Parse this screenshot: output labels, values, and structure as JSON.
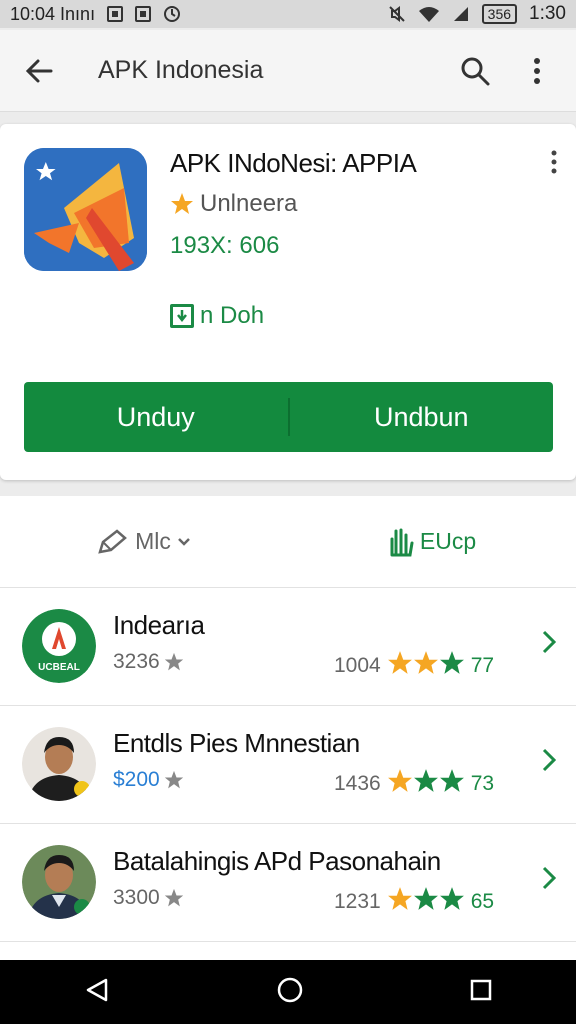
{
  "status_bar": {
    "left_text": "10:04 Inını",
    "battery_text": "356",
    "time": "1:30"
  },
  "app_bar": {
    "title": "APK Indonesia",
    "icons": [
      "back-arrow-icon",
      "search-icon",
      "more-vert-icon"
    ]
  },
  "app_card": {
    "name": "APK INdoNesi: APPIA",
    "rating_label": "Unlneera",
    "size_text": "193X: 606",
    "install_label": "n Doh",
    "buttons": [
      "Unduy",
      "Undbun"
    ]
  },
  "tabs": {
    "left_label": "Mlc",
    "right_label": "EUcp"
  },
  "list": [
    {
      "title": "Indearıa",
      "count": "3236",
      "rating_count": "1004",
      "score": "77",
      "star_colors": [
        "#f5a623",
        "#f5a623",
        "#1b8a45"
      ]
    },
    {
      "title": "Entdls Pies Mnnestian",
      "count": "$200",
      "rating_count": "1436",
      "score": "73",
      "star_colors": [
        "#f5a623",
        "#1b8a45",
        "#1b8a45"
      ]
    },
    {
      "title": "Batalahingis APd Pasonahain",
      "count": "3300",
      "rating_count": "1231",
      "score": "65",
      "star_colors": [
        "#f5a623",
        "#1b8a45",
        "#1b8a45"
      ]
    }
  ],
  "avatar_badge_text": "UCBEAL",
  "colors": {
    "accent_green": "#138a3e",
    "star_orange": "#f5a623",
    "link_blue": "#2a7fd4"
  }
}
